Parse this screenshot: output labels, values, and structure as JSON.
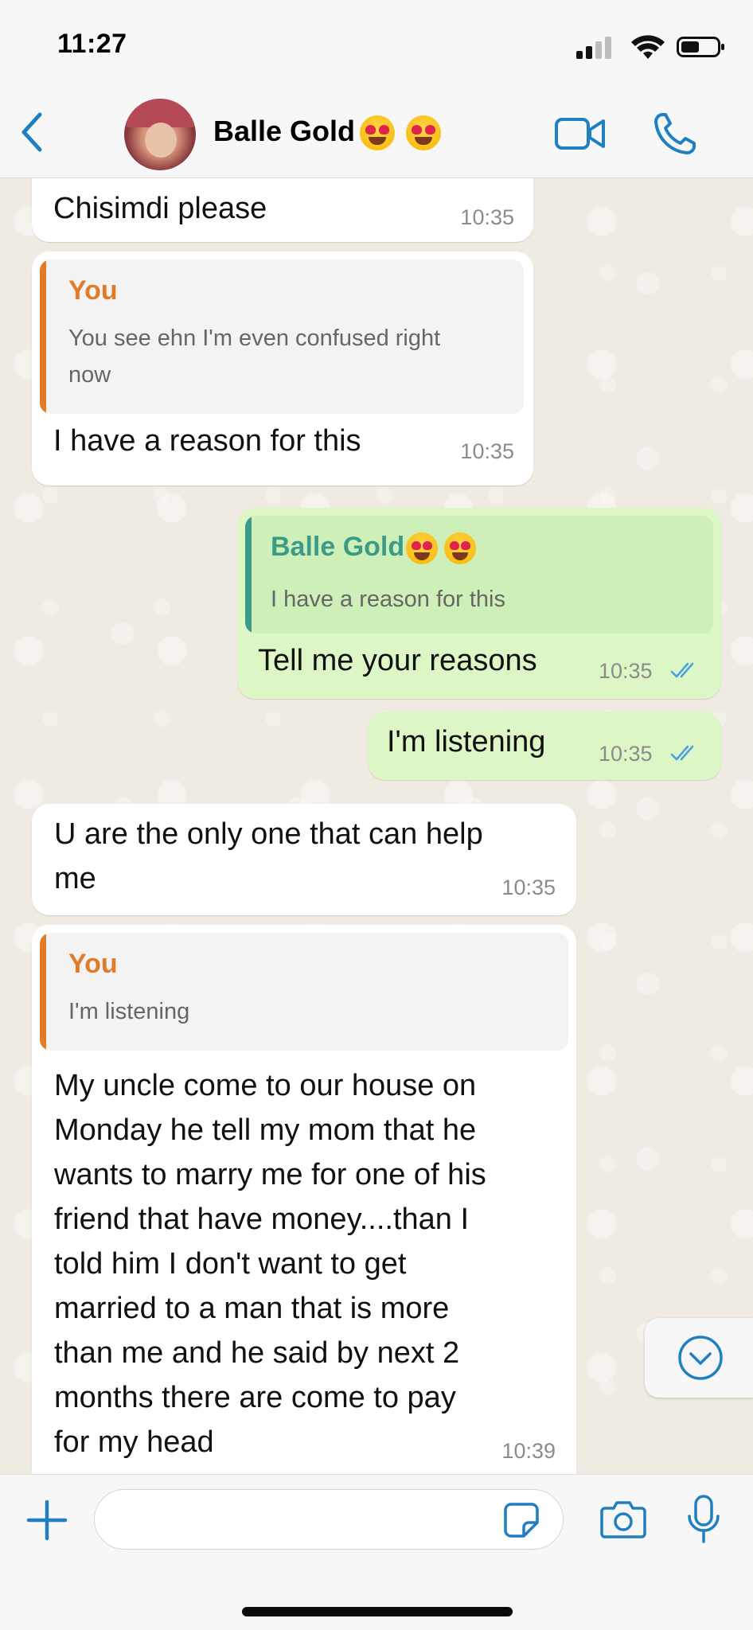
{
  "status_bar": {
    "time": "11:27"
  },
  "header": {
    "contact_name": "Balle Gold"
  },
  "messages": [
    {
      "direction": "in",
      "text": "Chisimdi please",
      "time": "10:35"
    },
    {
      "direction": "in",
      "quote_author": "You",
      "quote_text_line1": "You see ehn I'm even confused right",
      "quote_text_line2": "now",
      "text": "I have a reason for this",
      "time": "10:35"
    },
    {
      "direction": "out",
      "quote_author": "Balle Gold",
      "quote_text": "I have a reason for this",
      "text": "Tell me your reasons",
      "time": "10:35"
    },
    {
      "direction": "out",
      "text": "I'm listening",
      "time": "10:35"
    },
    {
      "direction": "in",
      "text_line1": "U are the only one that can help",
      "text_line2": "me",
      "time": "10:35"
    },
    {
      "direction": "in",
      "quote_author": "You",
      "quote_text": "I'm listening",
      "lines": [
        "My uncle come to our house on",
        "Monday he tell my mom that he",
        "wants to marry me for one of his",
        "friend that have money....than I",
        "told him I don't want to get",
        "married to a man that is more",
        "than me and he said by next 2",
        "months there are come to pay",
        "for my head"
      ],
      "time": "10:39"
    }
  ],
  "input": {
    "placeholder": ""
  },
  "colors": {
    "accent": "#1f7fc0",
    "outgoing_bubble": "#dcf7c5",
    "incoming_bubble": "#ffffff",
    "quote_you": "#e07b2a",
    "quote_contact": "#3c9b86",
    "read_ticks": "#4a9fe0"
  },
  "icons": [
    "back-chevron-icon",
    "video-call-icon",
    "phone-icon",
    "scroll-down-icon",
    "plus-icon",
    "sticker-icon",
    "camera-icon",
    "microphone-icon"
  ]
}
